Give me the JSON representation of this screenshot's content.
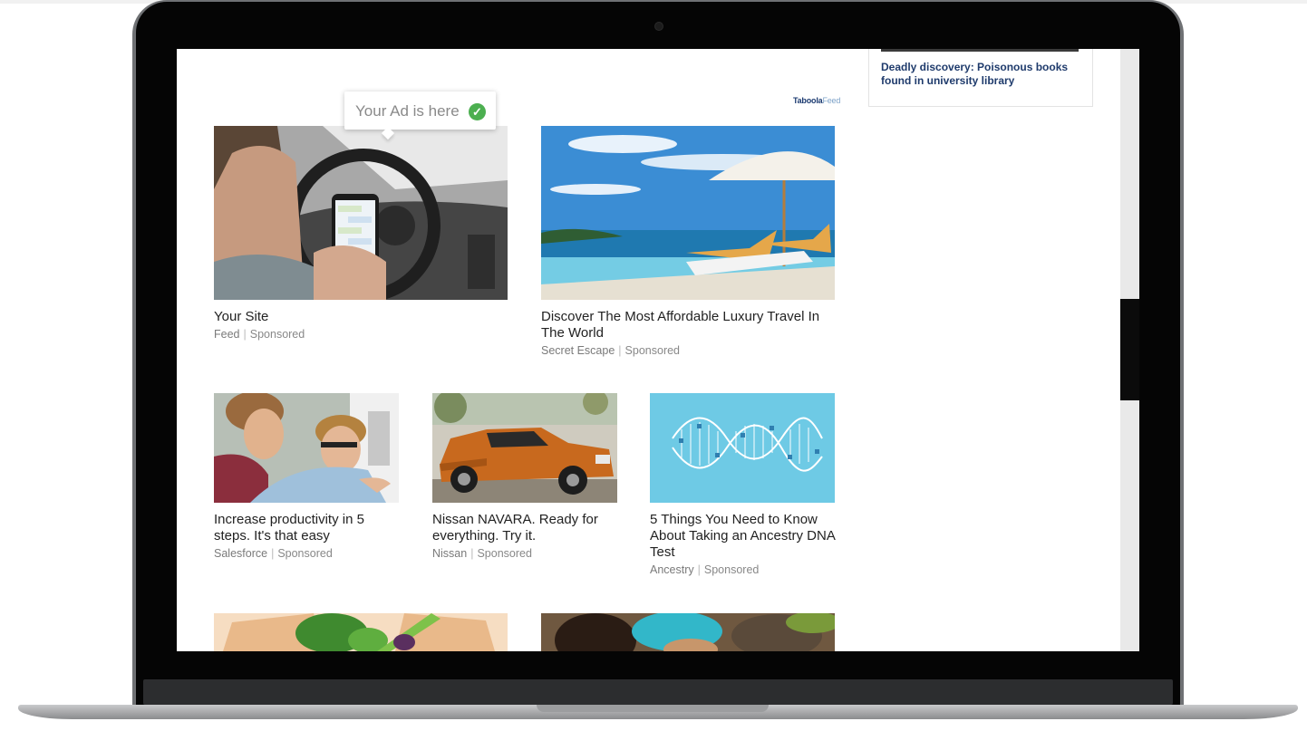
{
  "sidebar_card": {
    "headline": "Deadly discovery: Poisonous books found in university library"
  },
  "feed_brand": {
    "name": "Taboola",
    "suffix": "Feed"
  },
  "ad_tooltip": {
    "text": "Your Ad is here"
  },
  "cards": [
    {
      "title": "Your Site",
      "source": "Feed",
      "label": "Sponsored",
      "image": "driver-texting-in-car"
    },
    {
      "title": "Discover The Most Affordable Luxury Travel In The World",
      "source": "Secret Escape",
      "label": "Sponsored",
      "image": "beach-umbrella-loungers"
    },
    {
      "title": "Increase productivity in 5 steps. It's that easy",
      "source": "Salesforce",
      "label": "Sponsored",
      "image": "two-men-at-wall"
    },
    {
      "title": "Nissan NAVARA. Ready for everything. Try it.",
      "source": "Nissan",
      "label": "Sponsored",
      "image": "orange-pickup-truck"
    },
    {
      "title": "5 Things You Need to Know About Taking an Ancestry DNA Test",
      "source": "Ancestry",
      "label": "Sponsored",
      "image": "dna-helix"
    },
    {
      "title": "",
      "source": "",
      "label": "",
      "image": "vegetable-box"
    },
    {
      "title": "",
      "source": "",
      "label": "",
      "image": "festival-people"
    }
  ],
  "colors": {
    "tooltip_check": "#4caf50",
    "dna_background": "#6ecae5",
    "sidebar_headline": "#1f3b6c",
    "scroll_thumb": "#0b0b0b"
  }
}
